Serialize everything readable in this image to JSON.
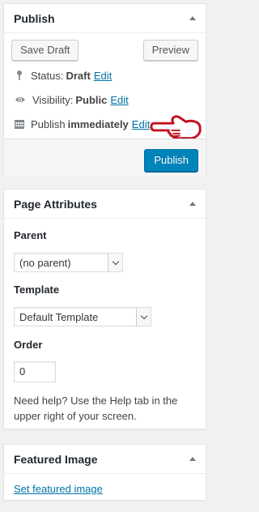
{
  "publish": {
    "title": "Publish",
    "save_draft_label": "Save Draft",
    "preview_label": "Preview",
    "status_label": "Status:",
    "status_value": "Draft",
    "visibility_label": "Visibility:",
    "visibility_value": "Public",
    "schedule_label": "Publish",
    "schedule_value": "immediately",
    "edit_label": "Edit",
    "publish_button_label": "Publish"
  },
  "page_attributes": {
    "title": "Page Attributes",
    "parent_label": "Parent",
    "parent_value": "(no parent)",
    "template_label": "Template",
    "template_value": "Default Template",
    "order_label": "Order",
    "order_value": "0",
    "help_text": "Need help? Use the Help tab in the upper right of your screen."
  },
  "featured_image": {
    "title": "Featured Image",
    "set_link": "Set featured image"
  },
  "colors": {
    "primary": "#0085ba",
    "link": "#0073aa",
    "pointer_hand": "#c1121f"
  },
  "icons": [
    "pin-icon",
    "eye-icon",
    "calendar-icon",
    "pointing-hand-icon",
    "collapse-arrow-icon",
    "chevron-down-icon"
  ]
}
